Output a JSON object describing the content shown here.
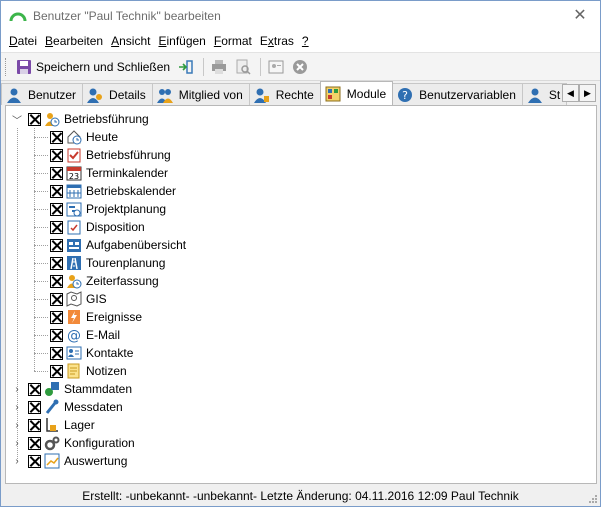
{
  "window": {
    "title": "Benutzer \"Paul Technik\" bearbeiten"
  },
  "menu": [
    {
      "label": "Datei",
      "key": "D",
      "rest": "atei"
    },
    {
      "label": "Bearbeiten",
      "key": "B",
      "rest": "earbeiten"
    },
    {
      "label": "Ansicht",
      "key": "A",
      "rest": "nsicht"
    },
    {
      "label": "Einfügen",
      "key": "E",
      "rest": "infügen"
    },
    {
      "label": "Format",
      "key": "F",
      "rest": "ormat"
    },
    {
      "label": "Extras",
      "key": "x",
      "rest": "tras",
      "prefix": "E"
    },
    {
      "label": "?",
      "key": "?",
      "rest": ""
    }
  ],
  "toolbar": {
    "save_label": "Speichern und Schließen"
  },
  "tabs": [
    "Benutzer",
    "Details",
    "Mitglied von",
    "Rechte",
    "Module",
    "Benutzervariablen",
    "St"
  ],
  "active_tab": "Module",
  "tree": {
    "root": "Betriebsführung",
    "children": [
      "Heute",
      "Betriebsführung",
      "Terminkalender",
      "Betriebskalender",
      "Projektplanung",
      "Disposition",
      "Aufgabenübersicht",
      "Tourenplanung",
      "Zeiterfassung",
      "GIS",
      "Ereignisse",
      "E-Mail",
      "Kontakte",
      "Notizen"
    ],
    "siblings": [
      "Stammdaten",
      "Messdaten",
      "Lager",
      "Konfiguration",
      "Auswertung"
    ]
  },
  "icons": {
    "root": "betriebsfuehrung-icon",
    "children": [
      "heute-icon",
      "checklist-icon",
      "calendar-23-icon",
      "calendar-grid-icon",
      "gantt-icon",
      "clipboard-check-icon",
      "task-overview-icon",
      "route-icon",
      "time-clock-icon",
      "map-icon",
      "event-bolt-icon",
      "email-at-icon",
      "contact-card-icon",
      "notes-icon"
    ],
    "siblings": [
      "shapes-icon",
      "probe-icon",
      "warehouse-icon",
      "gears-icon",
      "report-chart-icon"
    ]
  },
  "status": "Erstellt: -unbekannt- -unbekannt-  Letzte Änderung: 04.11.2016 12:09 Paul Technik"
}
